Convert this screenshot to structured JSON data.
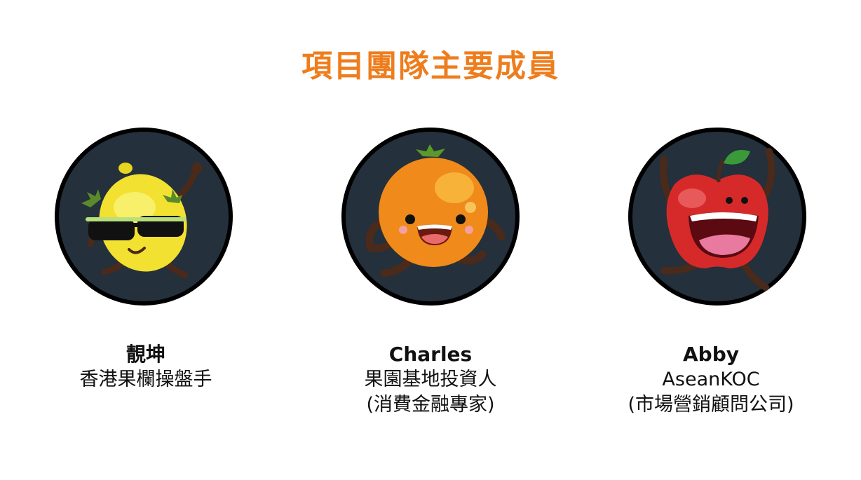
{
  "slide": {
    "title": "項目團隊主要成員",
    "title_color": "#ee7d1d",
    "circle_bg": "#24303b"
  },
  "members": [
    {
      "name": "靚坤",
      "lines": [
        "香港果欄操盤手"
      ],
      "avatar": "lemon-with-sunglasses-icon"
    },
    {
      "name": "Charles",
      "lines": [
        "果園基地投資人",
        "(消費金融專家)"
      ],
      "avatar": "orange-character-icon"
    },
    {
      "name": "Abby",
      "lines": [
        "AseanKOC",
        "(市場營銷顧問公司)"
      ],
      "avatar": "apple-character-icon"
    }
  ]
}
